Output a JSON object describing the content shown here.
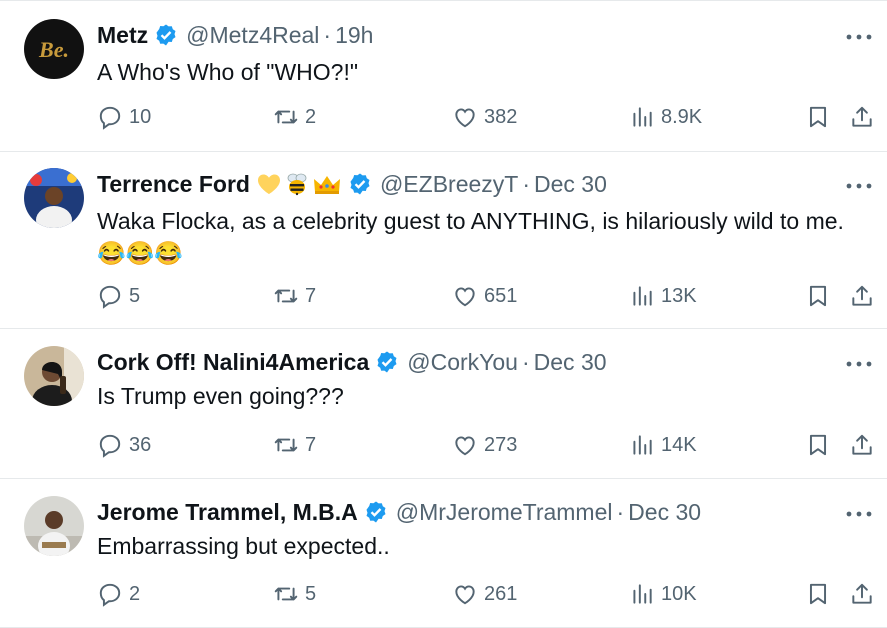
{
  "tweets": [
    {
      "name": "Metz",
      "handle": "@Metz4Real",
      "time": "19h",
      "text": [
        "A Who's Who of \"WHO?!\""
      ],
      "emoji_after_name": [],
      "avatar": {
        "bg": "#111111",
        "fg": "#c89b3c",
        "letters": "Be."
      },
      "reply": "10",
      "retweet": "2",
      "like": "382",
      "views": "8.9K"
    },
    {
      "name": "Terrence Ford",
      "handle": "@EZBreezyT",
      "time": "Dec 30",
      "text": [
        "Waka Flocka, as a celebrity guest to ANYTHING, is hilariously wild to me.",
        "😂😂😂"
      ],
      "emoji_after_name": [
        "yellow-heart",
        "bee",
        "crown"
      ],
      "avatar": {
        "bg": "#1e3b7a"
      },
      "reply": "5",
      "retweet": "7",
      "like": "651",
      "views": "13K"
    },
    {
      "name": "Cork Off! Nalini4America",
      "handle": "@CorkYou",
      "time": "Dec 30",
      "text": [
        "Is Trump even going???"
      ],
      "emoji_after_name": [],
      "avatar": {
        "bg": "#c9b79a"
      },
      "reply": "36",
      "retweet": "7",
      "like": "273",
      "views": "14K"
    },
    {
      "name": "Jerome Trammel, M.B.A",
      "handle": "@MrJeromeTrammel",
      "time": "Dec 30",
      "text": [
        "Embarrassing but expected.."
      ],
      "emoji_after_name": [],
      "avatar": {
        "bg": "#d7d7d2"
      },
      "reply": "2",
      "retweet": "5",
      "like": "261",
      "views": "10K"
    }
  ],
  "colors": {
    "verified": "#1d9bf0",
    "muted": "#536471",
    "text": "#0f1419",
    "divider": "#e6e9eb"
  },
  "icons": [
    "reply-icon",
    "retweet-icon",
    "like-icon",
    "views-icon",
    "bookmark-icon",
    "share-icon",
    "more-icon",
    "verified-badge-icon"
  ]
}
